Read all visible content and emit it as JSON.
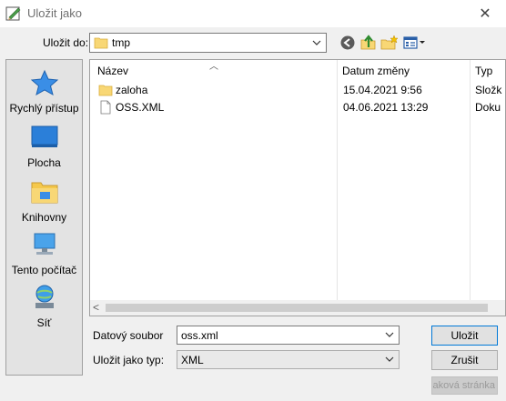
{
  "window": {
    "title": "Uložit jako",
    "close_glyph": "✕"
  },
  "location": {
    "label": "Uložit do:",
    "current": "tmp"
  },
  "toolbar": {
    "icons": [
      "back-icon",
      "up-folder-icon",
      "new-folder-icon",
      "view-menu-icon"
    ]
  },
  "places": [
    {
      "label": "Rychlý přístup",
      "icon": "star-icon"
    },
    {
      "label": "Plocha",
      "icon": "desktop-icon"
    },
    {
      "label": "Knihovny",
      "icon": "libraries-icon"
    },
    {
      "label": "Tento počítač",
      "icon": "computer-icon"
    },
    {
      "label": "Síť",
      "icon": "network-icon"
    }
  ],
  "filelist": {
    "columns": {
      "name": "Název",
      "date": "Datum změny",
      "type": "Typ"
    },
    "rows": [
      {
        "name": "zaloha",
        "date": "15.04.2021 9:56",
        "type": "Složk",
        "icon": "folder-icon"
      },
      {
        "name": "OSS.XML",
        "date": "04.06.2021 13:29",
        "type": "Doku",
        "icon": "file-icon"
      }
    ]
  },
  "form": {
    "filename_label": "Datový soubor",
    "filename_value": "oss.xml",
    "filetype_label": "Uložit jako typ:",
    "filetype_value": "XML"
  },
  "buttons": {
    "save": "Uložit",
    "cancel": "Zrušit",
    "help": "Nápověda k této stránka",
    "help_visible": "aková stránka"
  },
  "colors": {
    "accent": "#0078d7",
    "folder": "#f8d775"
  }
}
